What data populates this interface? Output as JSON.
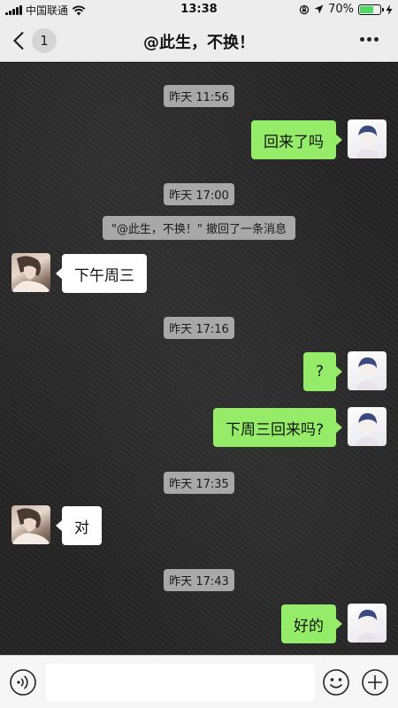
{
  "status_bar": {
    "carrier": "中国联通",
    "time": "13:38",
    "battery_percent": "70%",
    "battery_level": 0.7,
    "battery_color": "#4cd964"
  },
  "navbar": {
    "back_icon": "chevron-left-icon",
    "unread_count": "1",
    "title": "@此生，不换！",
    "more_icon": "more-dots-icon"
  },
  "colors": {
    "outgoing_bubble": "#95ec69",
    "incoming_bubble": "#ffffff",
    "timestamp_bg": "#a8a8a8"
  },
  "messages": [
    {
      "kind": "timestamp",
      "text": "昨天 11:56"
    },
    {
      "kind": "outgoing",
      "text": "回来了吗"
    },
    {
      "kind": "timestamp",
      "text": "昨天 17:00"
    },
    {
      "kind": "system",
      "text": "\"@此生，不换！\" 撤回了一条消息"
    },
    {
      "kind": "incoming",
      "text": "下午周三"
    },
    {
      "kind": "timestamp",
      "text": "昨天 17:16"
    },
    {
      "kind": "outgoing",
      "text": "?"
    },
    {
      "kind": "outgoing",
      "text": "下周三回来吗?"
    },
    {
      "kind": "timestamp",
      "text": "昨天 17:35"
    },
    {
      "kind": "incoming",
      "text": "对"
    },
    {
      "kind": "timestamp",
      "text": "昨天 17:43"
    },
    {
      "kind": "outgoing",
      "text": "好的"
    }
  ],
  "input_bar": {
    "voice_icon": "voice-icon",
    "text_value": "",
    "emoji_icon": "emoji-icon",
    "add_icon": "plus-circle-icon"
  }
}
